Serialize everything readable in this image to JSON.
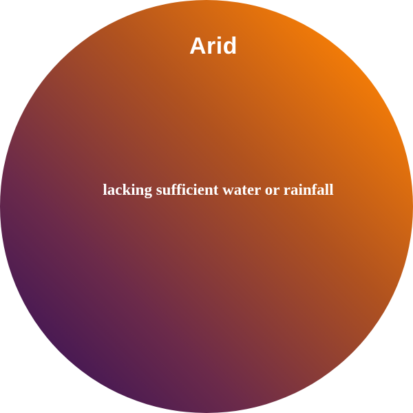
{
  "card": {
    "title": "Arid",
    "definition": "lacking sufficient water or rainfall",
    "colors": {
      "gradient_start": "#2a0b5c",
      "gradient_end": "#f47b06",
      "text": "#ffffff"
    }
  }
}
